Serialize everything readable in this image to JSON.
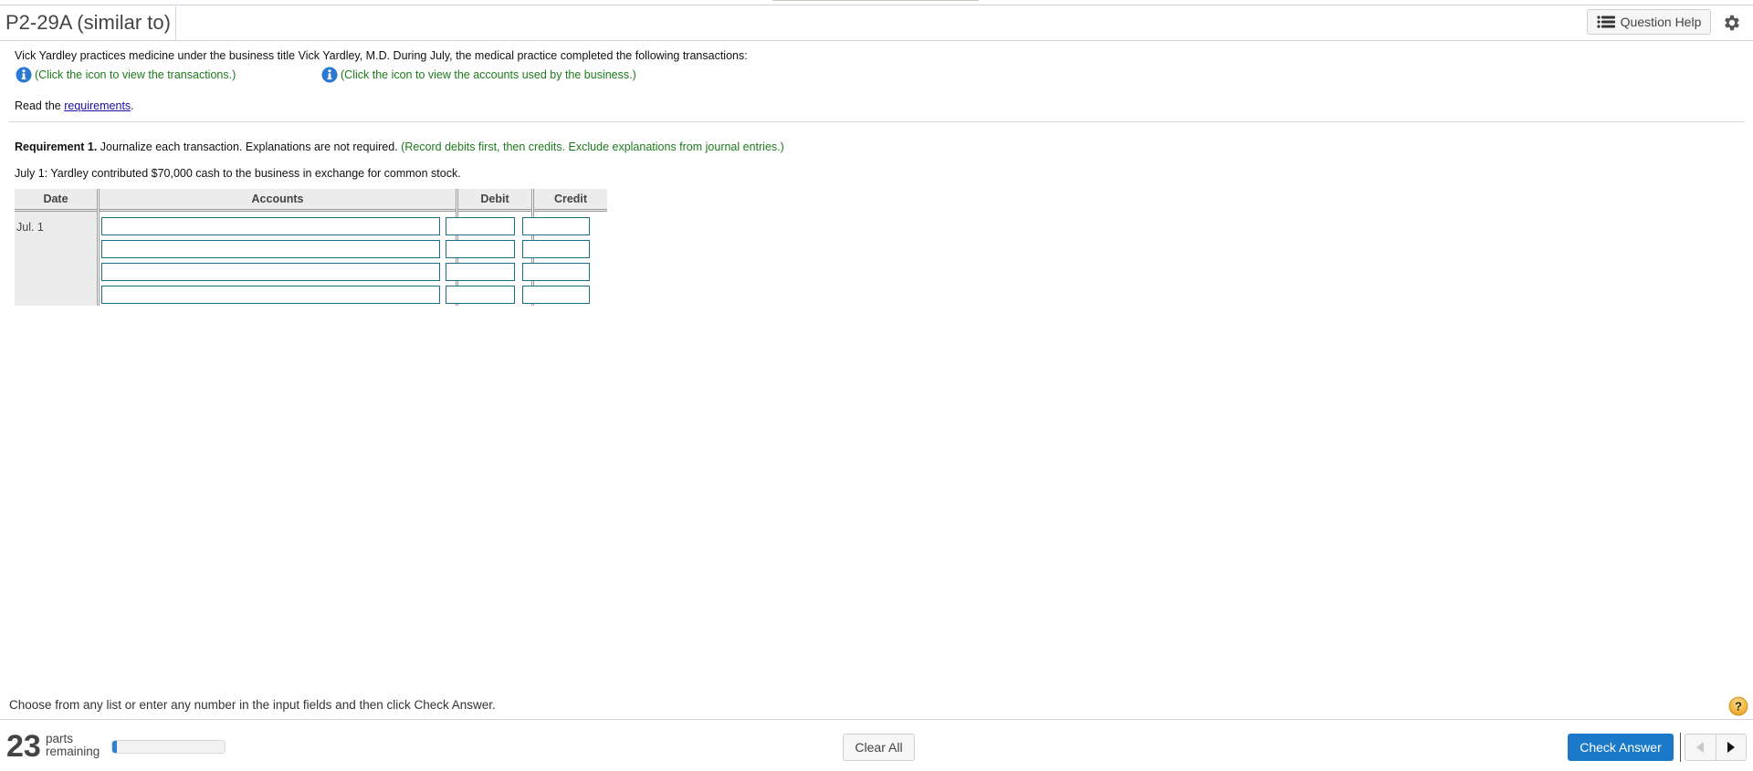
{
  "header": {
    "title": "P2-29A (similar to)",
    "question_help_label": "Question Help",
    "icons": {
      "help_list": "list-icon",
      "settings": "gear-icon"
    }
  },
  "problem": {
    "intro": "Vick Yardley practices medicine under the business title Vick Yardley, M.D. During July, the medical practice completed the following transactions:",
    "info_transactions": "(Click the icon to view the transactions.)",
    "info_accounts": "(Click the icon to view the accounts used by the business.)",
    "read_prefix": "Read the ",
    "read_link": "requirements",
    "read_suffix": ".",
    "requirement_label": "Requirement 1.",
    "requirement_text": " Journalize each transaction. Explanations are not required. ",
    "requirement_hint": "(Record debits first, then credits. Exclude explanations from journal entries.)",
    "transaction": "July 1: Yardley contributed $70,000 cash to the business in exchange for common stock."
  },
  "journal": {
    "columns": [
      "Date",
      "Accounts",
      "Debit",
      "Credit"
    ],
    "date": "Jul. 1",
    "rows": [
      {
        "account": "",
        "debit": "",
        "credit": ""
      },
      {
        "account": "",
        "debit": "",
        "credit": ""
      },
      {
        "account": "",
        "debit": "",
        "credit": ""
      },
      {
        "account": "",
        "debit": "",
        "credit": ""
      }
    ]
  },
  "footer": {
    "instruction": "Choose from any list or enter any number in the input fields and then click Check Answer.",
    "parts_remaining": "23",
    "parts_label_1": "parts",
    "parts_label_2": "remaining",
    "progress_fraction": 0.04,
    "clear_all_label": "Clear All",
    "check_answer_label": "Check Answer",
    "help_symbol": "?",
    "accent_color": "#1a79c9"
  }
}
